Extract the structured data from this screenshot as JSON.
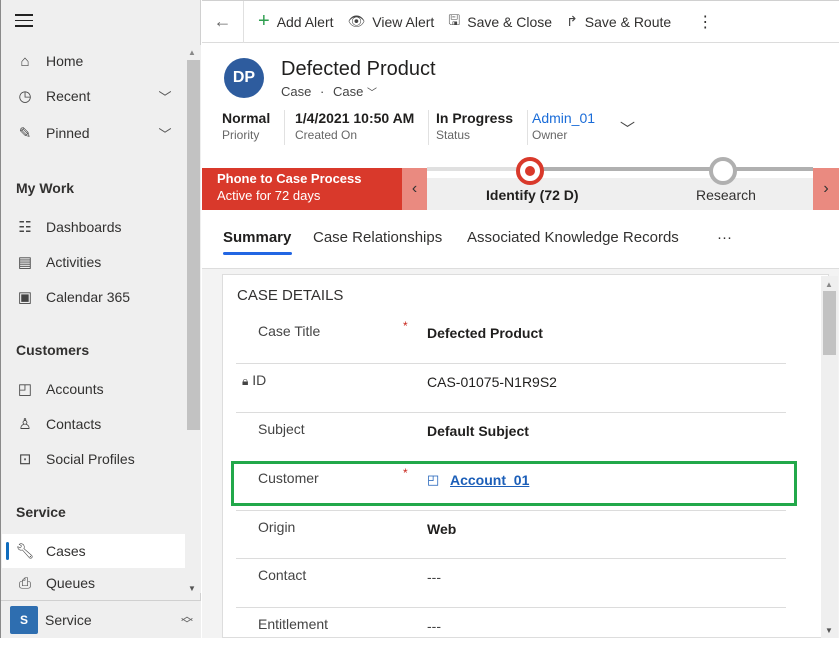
{
  "sidebar": {
    "menu_icon": "hamburger-icon",
    "top_items": [
      {
        "label": "Home",
        "icon": "home-icon"
      },
      {
        "label": "Recent",
        "icon": "clock-icon",
        "expandable": true
      },
      {
        "label": "Pinned",
        "icon": "pin-icon",
        "expandable": true
      }
    ],
    "sections": [
      {
        "title": "My Work",
        "items": [
          {
            "label": "Dashboards",
            "icon": "dashboard-icon"
          },
          {
            "label": "Activities",
            "icon": "clipboard-icon"
          },
          {
            "label": "Calendar 365",
            "icon": "calendar-icon"
          }
        ]
      },
      {
        "title": "Customers",
        "items": [
          {
            "label": "Accounts",
            "icon": "account-icon"
          },
          {
            "label": "Contacts",
            "icon": "person-icon"
          },
          {
            "label": "Social Profiles",
            "icon": "profile-icon"
          }
        ]
      },
      {
        "title": "Service",
        "items": [
          {
            "label": "Cases",
            "icon": "wrench-icon",
            "active": true
          },
          {
            "label": "Queues",
            "icon": "queue-icon"
          }
        ]
      }
    ],
    "area": {
      "badge": "S",
      "label": "Service"
    }
  },
  "commandbar": {
    "back": "back-arrow-icon",
    "buttons": [
      {
        "label": "Add Alert",
        "icon": "plus-icon"
      },
      {
        "label": "View Alert",
        "icon": "eye-icon"
      },
      {
        "label": "Save & Close",
        "icon": "save-close-icon"
      },
      {
        "label": "Save & Route",
        "icon": "route-icon"
      }
    ],
    "more": "⋮"
  },
  "header": {
    "avatar": "DP",
    "title": "Defected Product",
    "entity": "Case",
    "form": "Case",
    "fields": [
      {
        "value": "Normal",
        "label": "Priority"
      },
      {
        "value": "1/4/2021 10:50 AM",
        "label": "Created On"
      },
      {
        "value": "In Progress",
        "label": "Status"
      },
      {
        "value": "Admin_01",
        "label": "Owner"
      }
    ]
  },
  "bpf": {
    "name": "Phone to Case Process",
    "duration": "Active for 72 days",
    "stages": [
      {
        "label": "Identify  (72 D)",
        "active": true
      },
      {
        "label": "Research",
        "active": false
      }
    ]
  },
  "tabs": [
    "Summary",
    "Case Relationships",
    "Associated Knowledge Records",
    "···"
  ],
  "section": {
    "title": "CASE DETAILS",
    "fields": [
      {
        "label": "Case Title",
        "required": true,
        "value": "Defected Product"
      },
      {
        "label": "ID",
        "locked": true,
        "value": "CAS-01075-N1R9S2"
      },
      {
        "label": "Subject",
        "value": "Default Subject"
      },
      {
        "label": "Customer",
        "required": true,
        "value": "Account_01",
        "link": true
      },
      {
        "label": "Origin",
        "value": "Web"
      },
      {
        "label": "Contact",
        "value": "---"
      },
      {
        "label": "Entitlement",
        "value": "---"
      }
    ]
  },
  "colors": {
    "accent": "#2266e3",
    "bpf_active": "#d9392b",
    "highlight": "#22a84a",
    "link": "#1b5eb8"
  }
}
